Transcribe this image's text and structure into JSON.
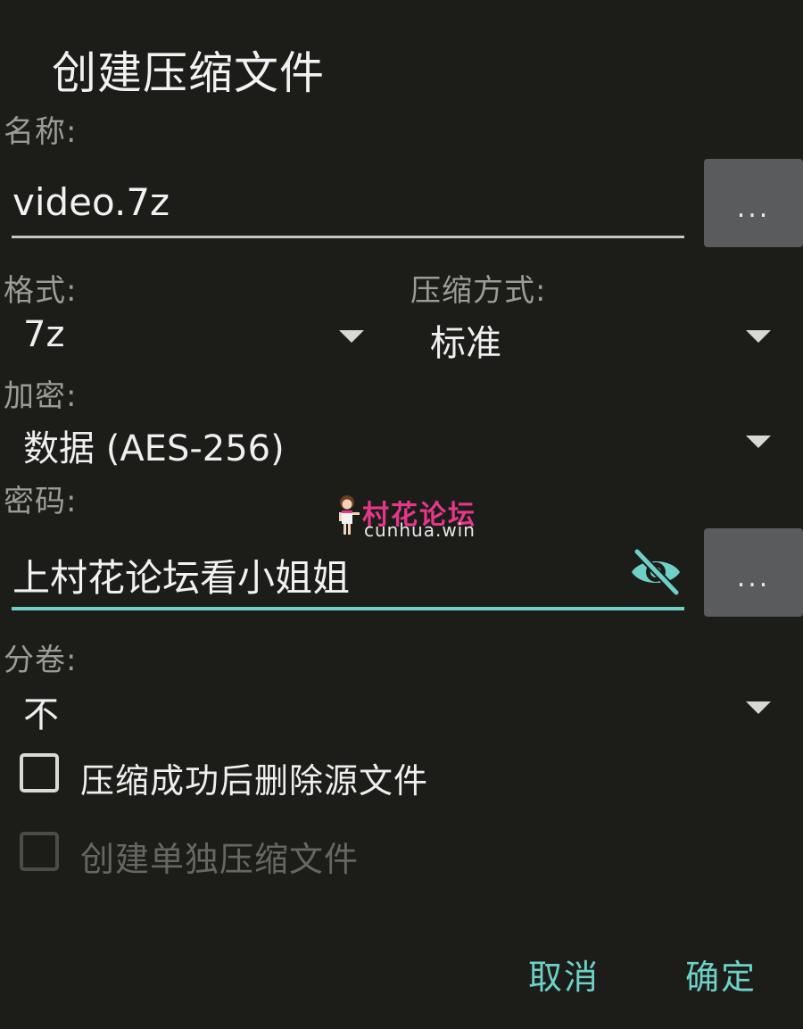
{
  "dialog": {
    "title": "创建压缩文件"
  },
  "name_field": {
    "label": "名称:",
    "value": "video.7z",
    "browse_label": "..."
  },
  "format": {
    "label": "格式:",
    "selected": "7z"
  },
  "compression": {
    "label": "压缩方式:",
    "selected": "标准"
  },
  "encryption": {
    "label": "加密:",
    "selected": "数据 (AES-256)"
  },
  "password": {
    "label": "密码:",
    "value": "上村花论坛看小姐姐",
    "browse_label": "..."
  },
  "split": {
    "label": "分卷:",
    "selected": "不"
  },
  "options": [
    {
      "label": "压缩成功后删除源文件",
      "checked": false,
      "enabled": true
    },
    {
      "label": "创建单独压缩文件",
      "checked": false,
      "enabled": false
    }
  ],
  "buttons": {
    "cancel": "取消",
    "ok": "确定"
  },
  "watermark": {
    "name": "村花论坛",
    "site": "cunhua.win"
  },
  "colors": {
    "accent": "#6fd0c8",
    "background": "#1c1d19",
    "watermark": "#e5378a"
  }
}
